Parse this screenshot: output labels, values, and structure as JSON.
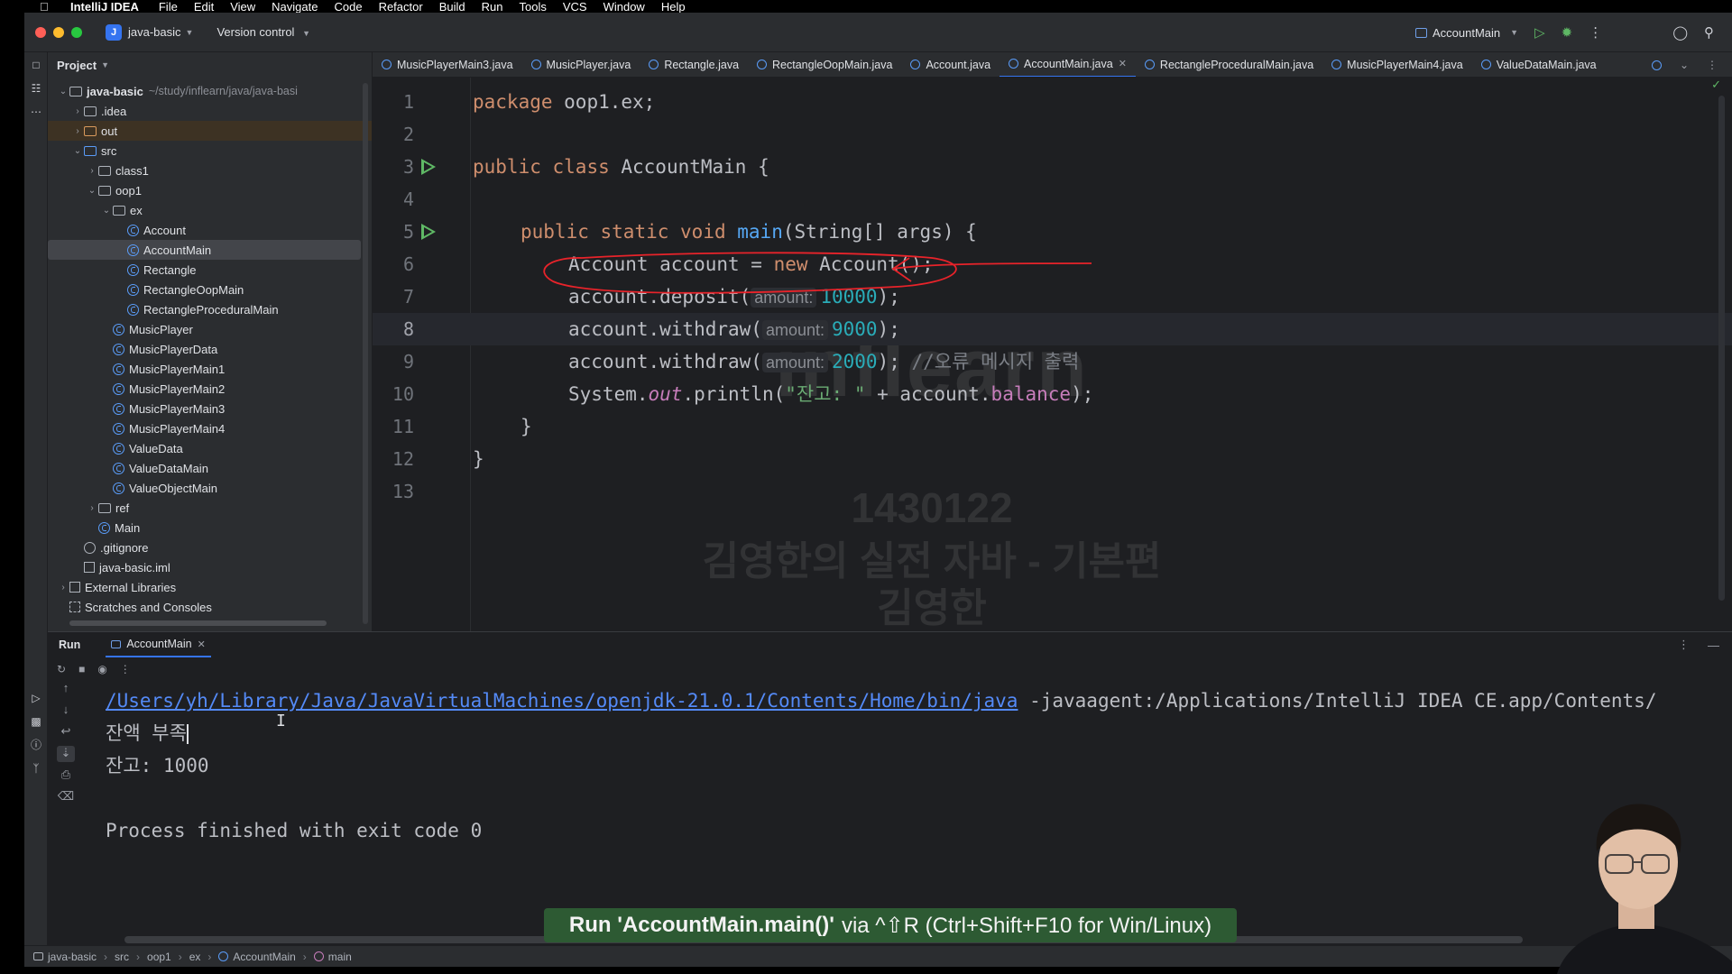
{
  "menubar": {
    "app": "IntelliJ IDEA",
    "items": [
      "File",
      "Edit",
      "View",
      "Navigate",
      "Code",
      "Refactor",
      "Build",
      "Run",
      "Tools",
      "VCS",
      "Window",
      "Help"
    ]
  },
  "toolbar": {
    "project_badge": "J",
    "project_name": "java-basic",
    "vcs_label": "Version control",
    "run_config": "AccountMain"
  },
  "project_panel": {
    "title": "Project",
    "root_name": "java-basic",
    "root_path": "~/study/inflearn/java/java-basi",
    "items": [
      {
        "label": "java-basic"
      },
      {
        "label": ".idea"
      },
      {
        "label": "out"
      },
      {
        "label": "src"
      },
      {
        "label": "class1"
      },
      {
        "label": "oop1"
      },
      {
        "label": "ex"
      },
      {
        "label": "Account"
      },
      {
        "label": "AccountMain"
      },
      {
        "label": "Rectangle"
      },
      {
        "label": "RectangleOopMain"
      },
      {
        "label": "RectangleProceduralMain"
      },
      {
        "label": "MusicPlayer"
      },
      {
        "label": "MusicPlayerData"
      },
      {
        "label": "MusicPlayerMain1"
      },
      {
        "label": "MusicPlayerMain2"
      },
      {
        "label": "MusicPlayerMain3"
      },
      {
        "label": "MusicPlayerMain4"
      },
      {
        "label": "ValueData"
      },
      {
        "label": "ValueDataMain"
      },
      {
        "label": "ValueObjectMain"
      },
      {
        "label": "ref"
      },
      {
        "label": "Main"
      },
      {
        "label": ".gitignore"
      },
      {
        "label": "java-basic.iml"
      },
      {
        "label": "External Libraries"
      },
      {
        "label": "Scratches and Consoles"
      }
    ]
  },
  "editor_tabs": [
    {
      "label": "MusicPlayerMain3.java"
    },
    {
      "label": "MusicPlayer.java"
    },
    {
      "label": "Rectangle.java"
    },
    {
      "label": "RectangleOopMain.java"
    },
    {
      "label": "Account.java"
    },
    {
      "label": "AccountMain.java",
      "active": true
    },
    {
      "label": "RectangleProceduralMain.java"
    },
    {
      "label": "MusicPlayerMain4.java"
    },
    {
      "label": "ValueDataMain.java"
    }
  ],
  "code": {
    "line_numbers": [
      "1",
      "2",
      "3",
      "4",
      "5",
      "6",
      "7",
      "8",
      "9",
      "10",
      "11",
      "12",
      "13"
    ],
    "current_line": "8",
    "tokens": {
      "package_kw": "package",
      "package_name": " oop1.ex;",
      "public_kw": "public",
      "class_kw": "class",
      "class_name": " AccountMain {",
      "static_kw": "static",
      "void_kw": "void",
      "main_fn": "main",
      "main_params": "(String[] args) {",
      "l6_decl": "Account account = ",
      "new_kw": "new",
      "l6_ctor": " Account();",
      "deposit_call": "account.deposit(",
      "withdraw_call": "account.withdraw(",
      "hint_amount": "amount:",
      "v_10000": "10000",
      "v_9000": "9000",
      "v_2000": "2000",
      "close_call": ");",
      "comment": "//오류 메시지 출력",
      "sys": "System.",
      "out_field": "out",
      "println": ".println(",
      "str_balance": "\"잔고: \"",
      "plus": " + account.",
      "balance_field": "balance",
      "close_brace": "}"
    }
  },
  "watermark": {
    "logo": "inflearn",
    "id": "1430122",
    "course": "김영한의 실전 자바 - 기본편",
    "author": "김영한"
  },
  "run_panel": {
    "title": "Run",
    "tab": "AccountMain",
    "console": {
      "java_path": "/Users/yh/Library/Java/JavaVirtualMachines/openjdk-21.0.1/Contents/Home/bin/java",
      "java_args": " -javaagent:/Applications/IntelliJ IDEA CE.app/Contents/",
      "line_error": "잔액 부족",
      "line_balance": "잔고: 1000",
      "line_finished": "Process finished with exit code 0"
    }
  },
  "tooltip": {
    "bold": "Run 'AccountMain.main()'",
    "rest": "via ^⇧R (Ctrl+Shift+F10 for Win/Linux)"
  },
  "statusbar": {
    "crumbs": [
      "java-basic",
      "src",
      "oop1",
      "ex",
      "AccountMain",
      "main"
    ]
  },
  "colors": {
    "accent": "#3574f0",
    "annotation": "#e8232a",
    "run_green": "#5fb865"
  }
}
